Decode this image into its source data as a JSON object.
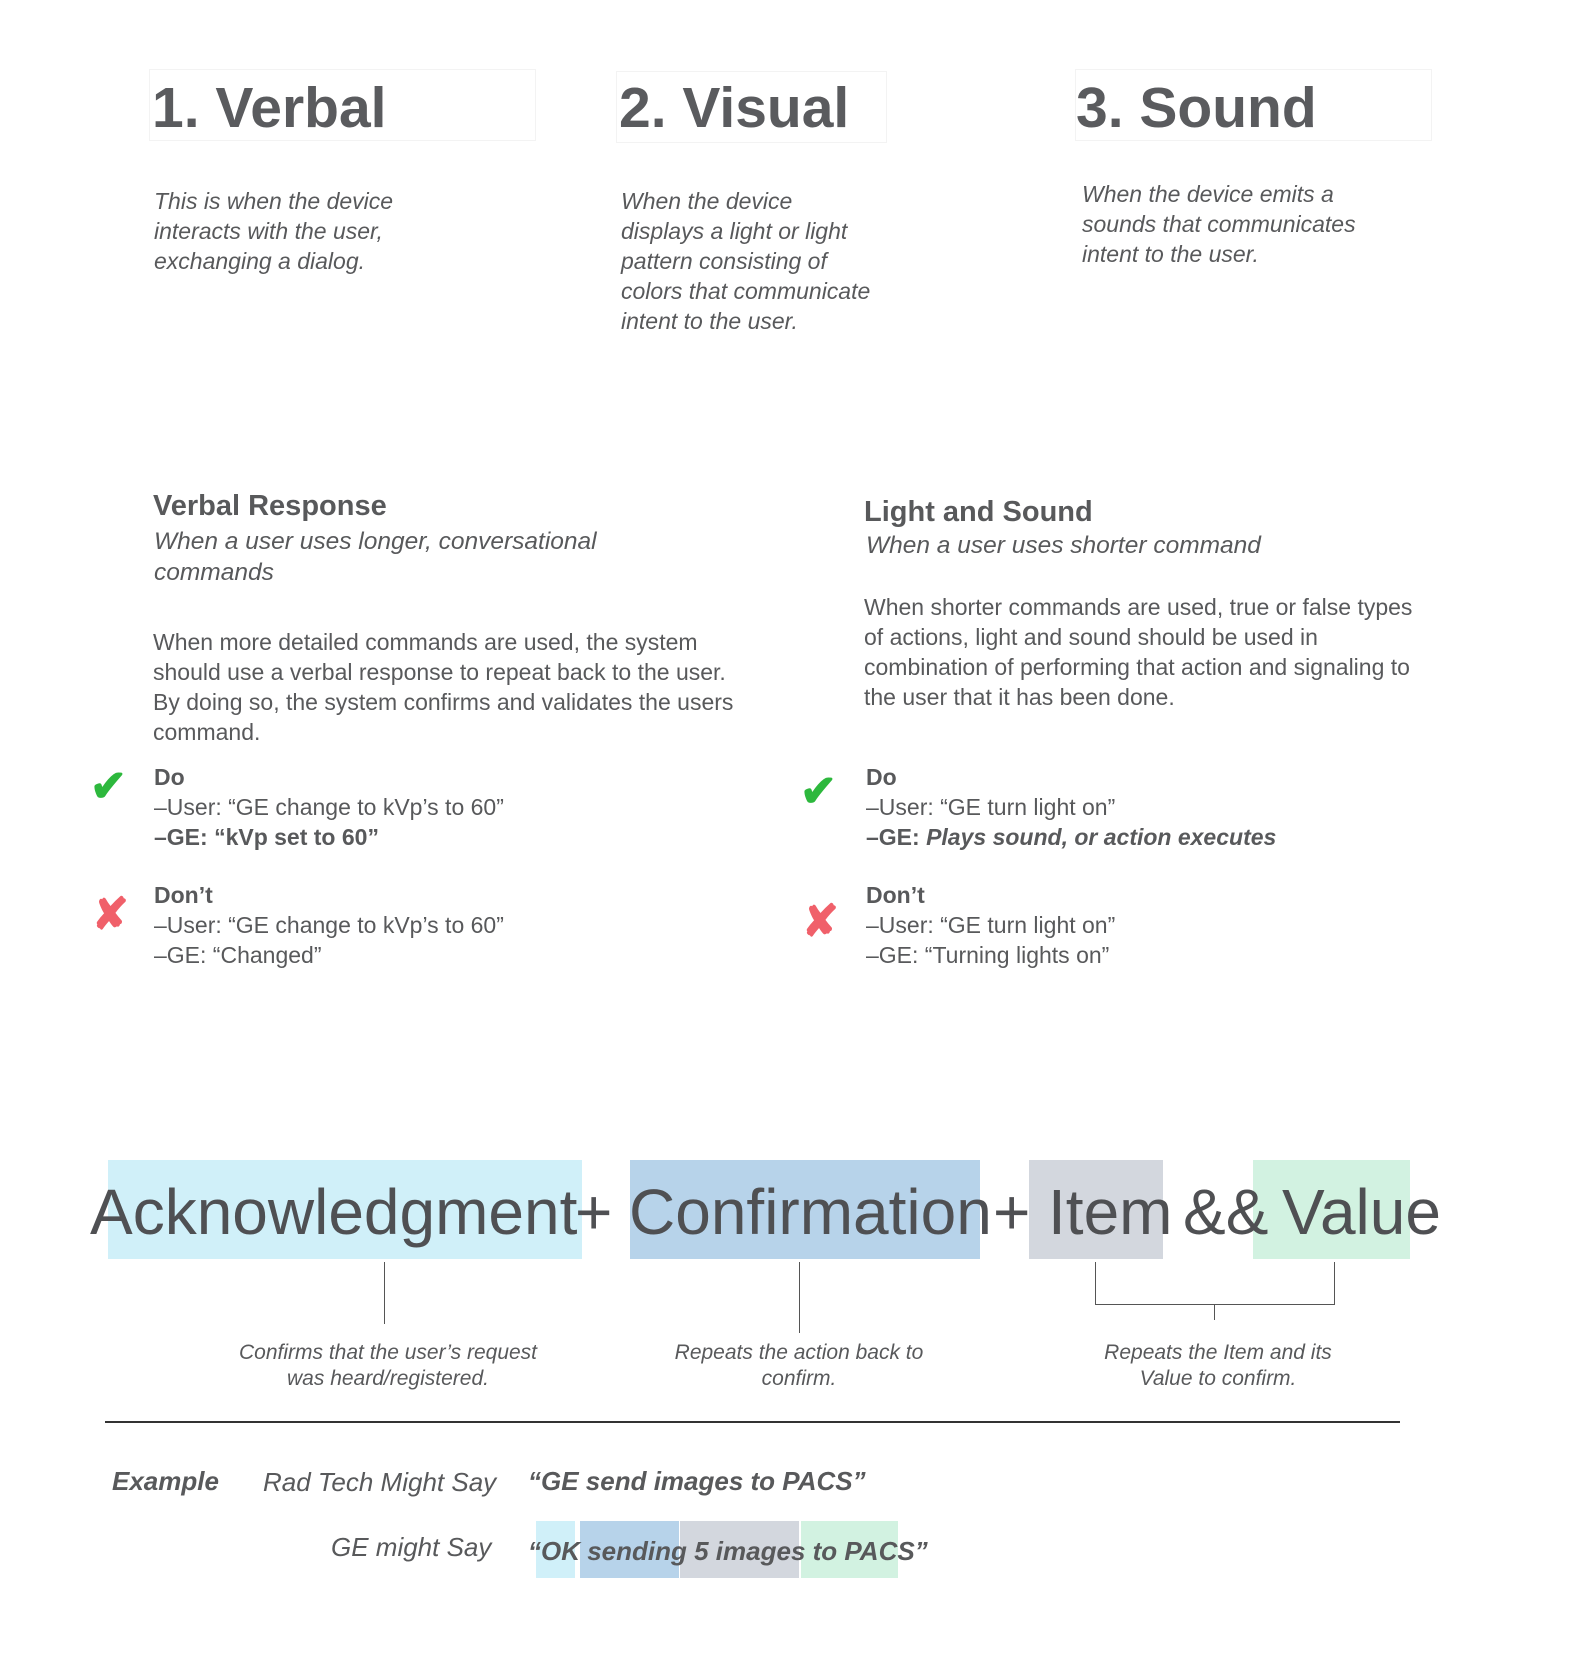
{
  "modes": [
    {
      "title": "1. Verbal",
      "desc": "This is when the device interacts with the user, exchanging a dialog."
    },
    {
      "title": "2. Visual",
      "desc": "When the device displays a light or light pattern consisting of colors that communicate intent to the user."
    },
    {
      "title": "3. Sound",
      "desc": "When the device emits a sounds that communicates intent to the user."
    }
  ],
  "verbal": {
    "title": "Verbal Response",
    "subtitle": "When a user uses longer, conversational commands",
    "body": "When more detailed commands are used, the system should use a verbal response to repeat back to the user. By doing so, the system confirms and validates the users command.",
    "do_label": "Do",
    "do_user": "–User: “GE change to kVp’s to 60”",
    "do_ge": "–GE: “kVp set to 60”",
    "dont_label": "Don’t",
    "dont_user": "–User: “GE change to kVp’s to 60”",
    "dont_ge": "–GE: “Changed”"
  },
  "light": {
    "title": "Light and Sound",
    "subtitle": "When a user uses shorter command",
    "body": "When shorter commands are used, true or false types of actions, light and sound should be used in combination of performing that action and signaling to the user that it has been done.",
    "do_label": "Do",
    "do_user": "–User: “GE turn light on”",
    "do_ge_prefix": "–GE: ",
    "do_ge": "Plays sound, or action executes",
    "dont_label": "Don’t",
    "dont_user": "–User: “GE turn light on”",
    "dont_ge": "–GE: “Turning lights on”"
  },
  "formula": {
    "ack": "Acknowledgment",
    "plus1": "+",
    "conf": "Confirmation",
    "plus2": "+",
    "item": "Item",
    "and": "&&",
    "value": "Value",
    "cap_ack": "Confirms that the user’s request was heard/registered.",
    "cap_conf": "Repeats the action back to confirm.",
    "cap_iv": "Repeats the Item and its Value to confirm."
  },
  "colors": {
    "ack": "#d0f0f9",
    "conf": "#b7d3ea",
    "item": "#d3d7de",
    "value": "#d2f2e1",
    "check": "#2db83d",
    "cross": "#f0606a"
  },
  "example": {
    "label": "Example",
    "rad_label": "Rad Tech Might Say",
    "rad_quote": "“GE send images to PACS”",
    "ge_label": "GE might Say",
    "ge_quote": "“OK sending 5 images to PACS”"
  }
}
